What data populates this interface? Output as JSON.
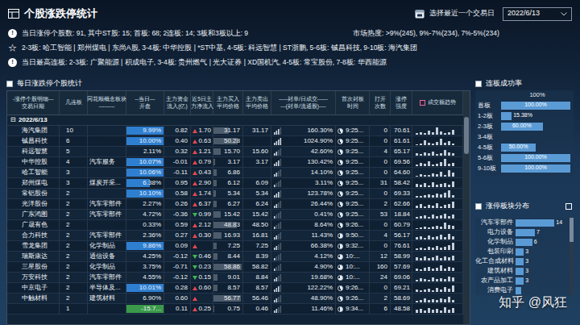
{
  "header": {
    "title": "个股涨跌停统计",
    "picker_label": "选择最近一个交易日",
    "date": "2022/6/13"
  },
  "info": [
    {
      "icon": "!",
      "kind": "badge",
      "text": "当日涨停个股数: 91, 其中ST股: 15; 首板: 68; 2连板: 14; 3板和3板以上: 9",
      "right": "市场热度: >9%(245), 9%-7%(234), 7%-5%(234)"
    },
    {
      "icon": "☆",
      "kind": "glyph",
      "text": "2-3板: 哈工智能 | 郑州煤电 | 东尚A股, 3-4板: 中华控股 | *ST中基, 4-5板: 科远智慧 | ST浙鹏, 5-6板: 铖昌科技, 9-10板: 海汽集团"
    },
    {
      "icon": "!",
      "kind": "badge",
      "text": "当日最高连板: 2-3板: 广聚能源 | 积成电子, 3-4板: 贵州燃气 | 光大证券 | XD国机汽, 4-5板: 常宝股份, 7-8板: 华西能源"
    }
  ],
  "table": {
    "title": "每日涨跌停个股统计",
    "checked": false,
    "columns": [
      {
        "lines": [
          "-涨停个股明细---",
          "交易日期"
        ]
      },
      {
        "lines": [
          "几连板"
        ]
      },
      {
        "lines": [
          "同花顺概念板块",
          "---------"
        ]
      },
      {
        "lines": [
          "--当日---",
          "开盘"
        ]
      },
      {
        "lines": [
          "主力资金",
          "流入(亿)"
        ]
      },
      {
        "lines": [
          "近5日主",
          "力净流入"
        ]
      },
      {
        "lines": [
          "主力买入",
          "平均价格"
        ]
      },
      {
        "lines": [
          "主力卖出",
          "平均价格"
        ]
      },
      {
        "lines": [
          "-----封单/日成交------",
          "---(封单/流通股)----"
        ]
      },
      {
        "lines": [
          "首次封板",
          "时间"
        ]
      },
      {
        "lines": [
          "打开",
          "次数"
        ]
      },
      {
        "lines": [
          "涨停",
          "强度"
        ]
      },
      {
        "lines": [
          "成交额趋势"
        ],
        "checked": false
      }
    ],
    "group": {
      "icon": "⊟",
      "label": "2022/6/13"
    },
    "rows": [
      {
        "name": "海汽集团",
        "boards": "10",
        "concept": "",
        "open": "9.99%",
        "open_level": 1,
        "open_color": "#2f7fd0",
        "flow": "0.82",
        "flow5": "1.70",
        "flow5_up": true,
        "buy": "31.17",
        "buy_level": 0.52,
        "sell": "31.17",
        "seal": "160.30%",
        "seal_level": 0.75,
        "first_time": "9:25...",
        "time_level": 0.5,
        "opens": "0",
        "strength": "70.61",
        "trend": [
          2,
          3,
          2,
          5,
          3,
          9,
          4,
          2,
          3,
          6
        ]
      },
      {
        "name": "铖昌科技",
        "boards": "6",
        "concept": "",
        "open": "10.00%",
        "open_level": 1,
        "open_color": "#2f7fd0",
        "flow": "0.40",
        "flow5": "0.63",
        "flow5_up": true,
        "buy": "50.28",
        "buy_level": 0.84,
        "sell": "",
        "seal": "1024.90%",
        "seal_level": 1,
        "first_time": "9:25...",
        "time_level": 0.5,
        "opens": "0",
        "strength": "61.61",
        "trend": [
          1,
          2,
          6,
          3,
          2,
          4,
          8,
          3,
          5,
          2
        ]
      },
      {
        "name": "科远智慧",
        "boards": "5",
        "concept": "",
        "open": "2.11%",
        "open_level": 0,
        "open_color": "#2f7fd0",
        "flow": "0.32",
        "flow5": "1.21",
        "flow5_up": true,
        "buy": "15.70",
        "buy_level": 0.26,
        "sell": "15.60",
        "seal": "42.60%",
        "seal_level": 0.5,
        "first_time": "9:25...",
        "time_level": 0.5,
        "opens": "4",
        "strength": "65.17",
        "trend": [
          3,
          2,
          4,
          3,
          5,
          2,
          3,
          7,
          4,
          3
        ]
      },
      {
        "name": "中华控股",
        "boards": "4",
        "concept": "汽车服务",
        "open": "10.07%",
        "open_level": 1,
        "open_color": "#2f7fd0",
        "flow": "-0.01",
        "flow5": "0.79",
        "flow5_up": true,
        "buy": "3.17",
        "buy_level": 0.05,
        "sell": "3.17",
        "seal": "130.42%",
        "seal_level": 0.75,
        "first_time": "9:25...",
        "time_level": 0.5,
        "opens": "0",
        "strength": "69.56",
        "trend": [
          2,
          4,
          3,
          6,
          2,
          3,
          5,
          9,
          3,
          4
        ]
      },
      {
        "name": "哈工智能",
        "boards": "3",
        "concept": "",
        "open": "10.06%",
        "open_level": 1,
        "open_color": "#2f7fd0",
        "flow": "-0.11",
        "flow5": "0.43",
        "flow5_up": true,
        "buy": "6.86",
        "buy_level": 0.11,
        "sell": "",
        "seal": "14.10%",
        "seal_level": 0.5,
        "first_time": "9:25...",
        "time_level": 0.5,
        "opens": "0",
        "strength": "64.60",
        "trend": [
          1,
          3,
          2,
          2,
          4,
          3,
          6,
          2,
          8,
          5
        ]
      },
      {
        "name": "郑州煤电",
        "boards": "3",
        "concept": "煤炭开采...",
        "open": "6.38%",
        "open_level": 0.64,
        "open_color": "#2f7fd0",
        "flow": "0.95",
        "flow5": "2.90",
        "flow5_up": true,
        "buy": "6.12",
        "buy_level": 0.1,
        "sell": "6.09",
        "seal": "3.11%",
        "seal_level": 0.25,
        "first_time": "9:25...",
        "time_level": 0.5,
        "opens": "31",
        "strength": "58.42",
        "trend": [
          4,
          3,
          5,
          2,
          6,
          3,
          4,
          5,
          3,
          7
        ]
      },
      {
        "name": "常铝股份",
        "boards": "2",
        "concept": "",
        "open": "10.10%",
        "open_level": 1,
        "open_color": "#2f7fd0",
        "flow": "0.58",
        "flow5": "1.74",
        "flow5_up": true,
        "buy": "5.34",
        "buy_level": 0.09,
        "sell": "5.34",
        "seal": "123.78%",
        "seal_level": 0.75,
        "first_time": "9:25...",
        "time_level": 0.5,
        "opens": "0",
        "strength": "69.33",
        "trend": [
          2,
          2,
          3,
          4,
          3,
          5,
          4,
          6,
          9,
          3
        ]
      },
      {
        "name": "光洋股份",
        "boards": "2",
        "concept": "汽车零部件",
        "open": "2.27%",
        "open_level": 0,
        "open_color": "#2f7fd0",
        "flow": "0.26",
        "flow5": "6.37",
        "flow5_up": true,
        "buy": "6.27",
        "buy_level": 0.1,
        "sell": "6.24",
        "seal": "26.44%",
        "seal_level": 0.5,
        "first_time": "9:25...",
        "time_level": 0.5,
        "opens": "2",
        "strength": "62.66",
        "trend": [
          3,
          5,
          2,
          4,
          3,
          6,
          2,
          4,
          5,
          8
        ]
      },
      {
        "name": "广东鸿图",
        "boards": "2",
        "concept": "汽车零部件",
        "open": "4.72%",
        "open_level": 0,
        "open_color": "#2f7fd0",
        "flow": "-0.36",
        "flow5": "0.99",
        "flow5_up": false,
        "buy": "15.42",
        "buy_level": 0.26,
        "sell": "15.42",
        "seal": "0.41%",
        "seal_level": 0.25,
        "first_time": "9:25...",
        "time_level": 0.5,
        "opens": "53",
        "strength": "18.84",
        "trend": [
          2,
          3,
          4,
          2,
          5,
          3,
          4,
          6,
          3,
          5
        ]
      },
      {
        "name": "广晟有色",
        "boards": "2",
        "concept": "",
        "open": "0.33%",
        "open_level": 0,
        "open_color": "#2f7fd0",
        "flow": "0.59",
        "flow5": "2.12",
        "flow5_up": true,
        "buy": "48.83",
        "buy_level": 0.81,
        "sell": "48.50",
        "seal": "8.64%",
        "seal_level": 0.25,
        "first_time": "9:26...",
        "time_level": 0.5,
        "opens": "0",
        "strength": "60.79",
        "trend": [
          1,
          2,
          3,
          2,
          3,
          4,
          3,
          8,
          5,
          4
        ]
      },
      {
        "name": "合力科技",
        "boards": "2",
        "concept": "汽车零部件",
        "open": "2.36%",
        "open_level": 0,
        "open_color": "#2f7fd0",
        "flow": "0.27",
        "flow5": "0.30",
        "flow5_up": true,
        "buy": "16.93",
        "buy_level": 0.28,
        "sell": "16.81",
        "seal": "11.43%",
        "seal_level": 0.5,
        "first_time": "9:50...",
        "time_level": 0.6,
        "opens": "4",
        "strength": "56.17",
        "trend": [
          3,
          4,
          2,
          5,
          3,
          4,
          6,
          3,
          7,
          4
        ]
      },
      {
        "name": "雪龙集团",
        "boards": "2",
        "concept": "化学制品",
        "open": "9.86%",
        "open_level": 1,
        "open_color": "#2f7fd0",
        "flow": "0.09",
        "flow5": "",
        "flow5_up": true,
        "buy": "7.25",
        "buy_level": 0.12,
        "sell": "7.25",
        "seal": "66.38%",
        "seal_level": 0.5,
        "first_time": "9:32...",
        "time_level": 0.55,
        "opens": "0",
        "strength": "76.61",
        "trend": [
          2,
          3,
          2,
          4,
          3,
          5,
          3,
          4,
          6,
          9
        ]
      },
      {
        "name": "瑞斯康达",
        "boards": "2",
        "concept": "通信设备",
        "open": "4.25%",
        "open_level": 0,
        "open_color": "#2f7fd0",
        "flow": "-0.12",
        "flow5": "0.46",
        "flow5_up": false,
        "buy": "8.44",
        "buy_level": 0.14,
        "sell": "8.39",
        "seal": "4.12%",
        "seal_level": 0.25,
        "first_time": "10:...",
        "time_level": 0.7,
        "opens": "12",
        "strength": "58.99",
        "trend": [
          4,
          3,
          5,
          3,
          4,
          6,
          3,
          5,
          4,
          6
        ]
      },
      {
        "name": "三星股份",
        "boards": "2",
        "concept": "化学制品",
        "open": "3.75%",
        "open_level": 0,
        "open_color": "#2f7fd0",
        "flow": "-0.71",
        "flow5": "0.23",
        "flow5_up": false,
        "buy": "58.86",
        "buy_level": 0.98,
        "sell": "58.82",
        "seal": "4.90%",
        "seal_level": 0.25,
        "first_time": "10:...",
        "time_level": 0.7,
        "opens": "160",
        "strength": "57.69",
        "trend": [
          3,
          2,
          4,
          5,
          3,
          4,
          7,
          3,
          5,
          4
        ]
      },
      {
        "name": "万安科技",
        "boards": "2",
        "concept": "汽车零部件",
        "open": "4.55%",
        "open_level": 0,
        "open_color": "#2f7fd0",
        "flow": "-0.12",
        "flow5": "0.15",
        "flow5_up": false,
        "buy": "9.01",
        "buy_level": 0.15,
        "sell": "8.84",
        "seal": "19.68%",
        "seal_level": 0.5,
        "first_time": "10:...",
        "time_level": 0.7,
        "opens": "24",
        "strength": "69.06",
        "trend": [
          2,
          4,
          3,
          2,
          5,
          3,
          4,
          3,
          6,
          5
        ]
      },
      {
        "name": "中京电子",
        "boards": "2",
        "concept": "半导体及...",
        "open": "10.01%",
        "open_level": 1,
        "open_color": "#2f7fd0",
        "flow": "0.28",
        "flow5": "0.60",
        "flow5_up": true,
        "buy": "8.57",
        "buy_level": 0.14,
        "sell": "8.57",
        "seal": "122.22%",
        "seal_level": 0.75,
        "first_time": "9:26...",
        "time_level": 0.5,
        "opens": "0",
        "strength": "69.21",
        "trend": [
          3,
          2,
          3,
          4,
          2,
          5,
          3,
          6,
          4,
          8
        ]
      },
      {
        "name": "中触材料",
        "boards": "2",
        "concept": "建筑材料",
        "open": "6.90%",
        "open_level": 0,
        "open_color": "#2f7fd0",
        "flow": "0.60",
        "flow5": "",
        "flow5_up": true,
        "buy": "56.77",
        "buy_level": 0.95,
        "sell": "56.46",
        "seal": "48.90%",
        "seal_level": 0.5,
        "first_time": "9:26...",
        "time_level": 0.5,
        "opens": "2",
        "strength": "58.69",
        "trend": [
          2,
          3,
          5,
          3,
          4,
          3,
          5,
          4,
          7,
          3
        ]
      },
      {
        "name": "",
        "boards": "1",
        "concept": "",
        "open": "-15.7...",
        "open_level": 1,
        "open_color": "#3a9a4a",
        "flow": "0.11",
        "flow5": "0.25",
        "flow5_up": true,
        "buy": "0.75",
        "buy_level": 0.01,
        "sell": "0.46",
        "seal": "11.46%",
        "seal_level": 0.5,
        "first_time": "9:34...",
        "time_level": 0.55,
        "opens": "6",
        "strength": "48.58",
        "trend": [
          4,
          5,
          3,
          6,
          4,
          5,
          3,
          7,
          4,
          6
        ]
      }
    ]
  },
  "success_rate": {
    "title": "连板成功率",
    "checked": false,
    "axis": "100%",
    "bars": [
      {
        "label": "首板",
        "value": 1,
        "text": "100.00%"
      },
      {
        "label": "1-2板",
        "value": 0.1538,
        "text": "15.38%"
      },
      {
        "label": "2-3板",
        "value": 0.6,
        "text": "60.00%"
      },
      {
        "label": "3-4板",
        "value": 0,
        "text": ""
      },
      {
        "label": "4-5板",
        "value": 0.5,
        "text": "50.00%"
      },
      {
        "label": "5-6板",
        "value": 1,
        "text": "100.00%"
      },
      {
        "label": "9-10板",
        "value": 1,
        "text": "100.00%"
      }
    ]
  },
  "sectors": {
    "title": "涨停板块分布",
    "checked": false,
    "max": 14,
    "bars": [
      {
        "label": "汽车零部件",
        "value": 14,
        "text": "14"
      },
      {
        "label": "电力设备",
        "value": 7,
        "text": "7"
      },
      {
        "label": "化学制品",
        "value": 6,
        "text": "6"
      },
      {
        "label": "包装印刷",
        "value": 3,
        "text": "3"
      },
      {
        "label": "化工合成材料",
        "value": 3,
        "text": "3"
      },
      {
        "label": "建筑材料",
        "value": 3,
        "text": "3"
      },
      {
        "label": "农产品加工",
        "value": 3,
        "text": "3"
      },
      {
        "label": "消费电子",
        "value": 2,
        "text": ""
      }
    ]
  },
  "watermark": "知乎 @风狂"
}
